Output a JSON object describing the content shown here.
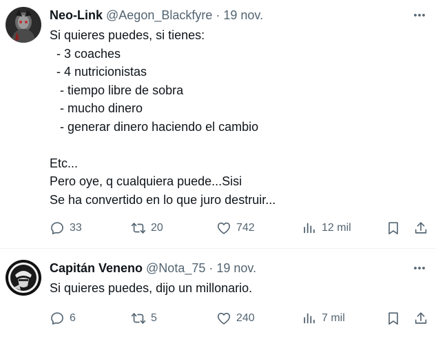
{
  "tweets": [
    {
      "display_name": "Neo-Link",
      "handle": "@Aegon_Blackfyre",
      "separator": "·",
      "date": "19 nov.",
      "lines": [
        "Si quieres puedes, si tienes:",
        "  - 3 coaches",
        "  - 4 nutricionistas",
        "   - tiempo libre de sobra",
        "   - mucho dinero",
        "   - generar dinero haciendo el cambio",
        "",
        "Etc...",
        "Pero oye, q cualquiera puede...Sisi",
        "Se ha convertido en lo que juro destruir..."
      ],
      "stats": {
        "replies": "33",
        "retweets": "20",
        "likes": "742",
        "views": "12 mil"
      }
    },
    {
      "display_name": "Capitán Veneno",
      "handle": "@Nota_75",
      "separator": "·",
      "date": "19 nov.",
      "lines": [
        "Si quieres puedes, dijo un millonario."
      ],
      "stats": {
        "replies": "6",
        "retweets": "5",
        "likes": "240",
        "views": "7 mil"
      }
    }
  ],
  "icons": {
    "more": "more-horizontal-icon",
    "reply": "reply-bubble-icon",
    "retweet": "retweet-icon",
    "like": "heart-icon",
    "views": "views-bar-chart-icon",
    "bookmark": "bookmark-icon",
    "share": "share-upload-icon"
  },
  "colors": {
    "text": "#0f1419",
    "secondary": "#536471",
    "divider": "#eff3f4",
    "background": "#ffffff"
  }
}
